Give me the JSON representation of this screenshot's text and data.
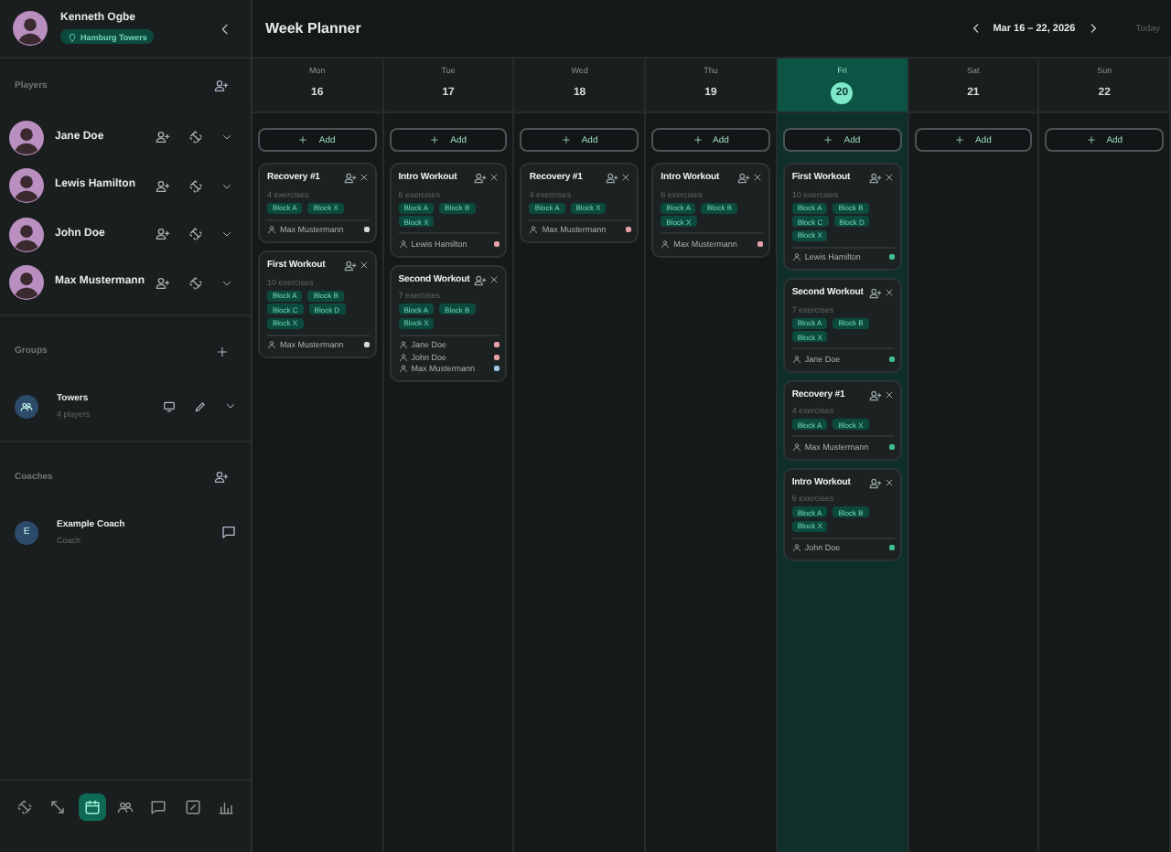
{
  "user": {
    "name": "Kenneth Ogbe",
    "team": "Hamburg Towers"
  },
  "players": {
    "label": "Players",
    "items": [
      {
        "name": "Jane Doe"
      },
      {
        "name": "Lewis Hamilton"
      },
      {
        "name": "John Doe"
      },
      {
        "name": "Max Mustermann"
      }
    ]
  },
  "groups": {
    "label": "Groups",
    "items": [
      {
        "name": "Towers",
        "subtitle": "4 players"
      }
    ]
  },
  "coaches": {
    "label": "Coaches",
    "items": [
      {
        "initial": "E",
        "name": "Example Coach",
        "subtitle": "Coach"
      }
    ]
  },
  "nav": [
    {
      "kind": "dumbbell",
      "selected": false
    },
    {
      "kind": "arrows",
      "selected": false
    },
    {
      "kind": "calendar",
      "selected": true
    },
    {
      "kind": "people",
      "selected": false
    },
    {
      "kind": "chat",
      "selected": false
    },
    {
      "kind": "edit",
      "selected": false
    },
    {
      "kind": "chart",
      "selected": false
    }
  ],
  "header": {
    "title": "Week Planner",
    "range": "Mar 16 – 22, 2026",
    "today": "Today"
  },
  "days": [
    {
      "weekday": "Mon",
      "date": "16",
      "selected": false,
      "add_label": "Add",
      "workouts": [
        {
          "title": "Recovery #1",
          "exercises": "4 exercises",
          "blocks": [
            "Block A",
            "Block X"
          ],
          "assignees": [
            {
              "name": "Max Mustermann",
              "color": "#d8d8d8"
            }
          ]
        },
        {
          "title": "First Workout",
          "exercises": "10 exercises",
          "blocks": [
            "Block A",
            "Block B",
            "Block C",
            "Block D",
            "Block X"
          ],
          "assignees": [
            {
              "name": "Max Mustermann",
              "color": "#d8d8d8"
            }
          ]
        }
      ]
    },
    {
      "weekday": "Tue",
      "date": "17",
      "selected": false,
      "add_label": "Add",
      "workouts": [
        {
          "title": "Intro Workout",
          "exercises": "6 exercises",
          "blocks": [
            "Block A",
            "Block B",
            "Block X"
          ],
          "assignees": [
            {
              "name": "Lewis Hamilton",
              "color": "#e8a0a8"
            }
          ]
        },
        {
          "title": "Second Workout",
          "exercises": "7 exercises",
          "blocks": [
            "Block A",
            "Block B",
            "Block X"
          ],
          "assignees": [
            {
              "name": "Jane Doe",
              "color": "#e8a0a8"
            },
            {
              "name": "John Doe",
              "color": "#e8a0a8"
            },
            {
              "name": "Max Mustermann",
              "color": "#9ec9e8"
            }
          ]
        }
      ]
    },
    {
      "weekday": "Wed",
      "date": "18",
      "selected": false,
      "add_label": "Add",
      "workouts": [
        {
          "title": "Recovery #1",
          "exercises": "4 exercises",
          "blocks": [
            "Block A",
            "Block X"
          ],
          "assignees": [
            {
              "name": "Max Mustermann",
              "color": "#e8a0a8"
            }
          ]
        }
      ]
    },
    {
      "weekday": "Thu",
      "date": "19",
      "selected": false,
      "add_label": "Add",
      "workouts": [
        {
          "title": "Intro Workout",
          "exercises": "6 exercises",
          "blocks": [
            "Block A",
            "Block B",
            "Block X"
          ],
          "assignees": [
            {
              "name": "Max Mustermann",
              "color": "#e8a0a8"
            }
          ]
        }
      ]
    },
    {
      "weekday": "Fri",
      "date": "20",
      "selected": true,
      "add_label": "Add",
      "workouts": [
        {
          "title": "First Workout",
          "exercises": "10 exercises",
          "blocks": [
            "Block A",
            "Block B",
            "Block C",
            "Block D",
            "Block X"
          ],
          "assignees": [
            {
              "name": "Lewis Hamilton",
              "color": "#3fbf8f"
            }
          ]
        },
        {
          "title": "Second Workout",
          "exercises": "7 exercises",
          "blocks": [
            "Block A",
            "Block B",
            "Block X"
          ],
          "assignees": [
            {
              "name": "Jane Doe",
              "color": "#3fbf8f"
            }
          ]
        },
        {
          "title": "Recovery #1",
          "exercises": "4 exercises",
          "blocks": [
            "Block A",
            "Block X"
          ],
          "assignees": [
            {
              "name": "Max Mustermann",
              "color": "#3fbf8f"
            }
          ]
        },
        {
          "title": "Intro Workout",
          "exercises": "6 exercises",
          "blocks": [
            "Block A",
            "Block B",
            "Block X"
          ],
          "assignees": [
            {
              "name": "John Doe",
              "color": "#3fbf8f"
            }
          ]
        }
      ]
    },
    {
      "weekday": "Sat",
      "date": "21",
      "selected": false,
      "add_label": "Add"
    },
    {
      "weekday": "Sun",
      "date": "22",
      "selected": false,
      "add_label": "Add"
    }
  ]
}
